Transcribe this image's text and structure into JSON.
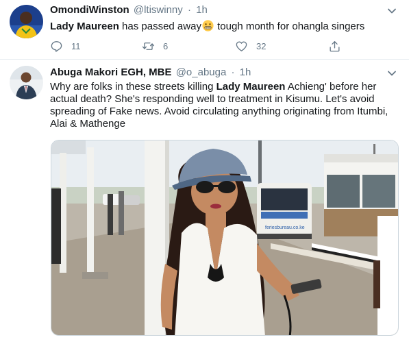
{
  "tweets": [
    {
      "display_name": "OmondiWinston",
      "handle": "@ltiswinny",
      "separator": "·",
      "time": "1h",
      "text_bold": "Lady Maureen",
      "text_rest": " has passed away",
      "text_after_emoji": "  tough month for ohangla singers",
      "emoji": "grimacing-face-emoji",
      "replies": "11",
      "retweets": "6",
      "likes": "32"
    },
    {
      "display_name": "Abuga Makori EGH, MBE",
      "handle": "@o_abuga",
      "separator": "·",
      "time": "1h",
      "text_before": "Why are folks in these streets killing ",
      "text_bold": "Lady Maureen",
      "text_after": " Achieng' before her actual death? She's responding well to treatment in Kisumu. Let's avoid spreading of Fake news. Avoid circulating anything originating from Itumbi, Alai & Mathenge",
      "media_sign_text": "feriesbureau.co.ke"
    }
  ],
  "colors": {
    "text": "#14171a",
    "secondary": "#657786",
    "divider": "#e6ecf0"
  }
}
